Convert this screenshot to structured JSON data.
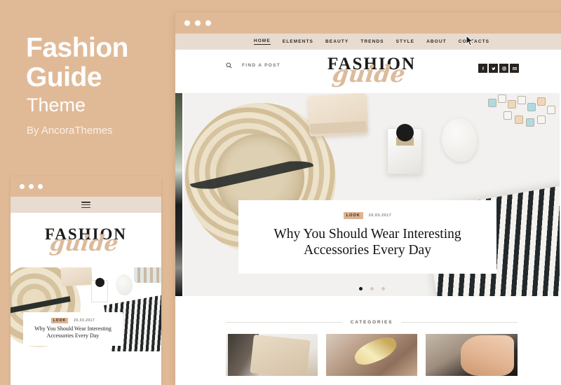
{
  "promo": {
    "title": "Fashion Guide",
    "subtitle": "Theme",
    "byline": "By AncoraThemes"
  },
  "colors": {
    "background": "#e0ba97",
    "titlebar": "#e0ba97",
    "navbar": "#e8dbd0",
    "accent": "#dbb492",
    "logo_script": "#dcbb9c",
    "text_dark": "#1d1b19",
    "social_button": "#272320"
  },
  "browser": {
    "titlebar_dots": 3
  },
  "site_nav": {
    "items": [
      {
        "label": "HOME",
        "active": true
      },
      {
        "label": "ELEMENTS",
        "active": false
      },
      {
        "label": "BEAUTY",
        "active": false
      },
      {
        "label": "TRENDS",
        "active": false
      },
      {
        "label": "STYLE",
        "active": false
      },
      {
        "label": "ABOUT",
        "active": false
      },
      {
        "label": "CONTACTS",
        "active": false
      }
    ]
  },
  "header": {
    "search_placeholder": "FIND A POST",
    "search_value": "",
    "logo_word": "FASHION",
    "logo_script": "guide",
    "social": [
      {
        "name": "facebook-icon"
      },
      {
        "name": "twitter-icon"
      },
      {
        "name": "instagram-icon"
      },
      {
        "name": "email-icon"
      }
    ]
  },
  "hero": {
    "badge": "LOOK",
    "date": "20.03.2017",
    "title": "Why You Should Wear Interesting Accessories Every Day",
    "dots": [
      {
        "active": true
      },
      {
        "active": false
      },
      {
        "active": false
      }
    ]
  },
  "categories": {
    "heading": "CATEGORIES",
    "cards": [
      {
        "alt": "beige-handbag-photo"
      },
      {
        "alt": "gold-jewelry-photo"
      },
      {
        "alt": "hand-holding-clutch-photo"
      }
    ]
  },
  "mobile": {
    "titlebar_dots": 3,
    "menu_icon": "hamburger-icon",
    "logo_word": "FASHION",
    "logo_script": "guide",
    "hero": {
      "badge": "LOOK",
      "date": "20.03.2017",
      "title": "Why You Should Wear Interesting Accessories Every Day"
    }
  }
}
